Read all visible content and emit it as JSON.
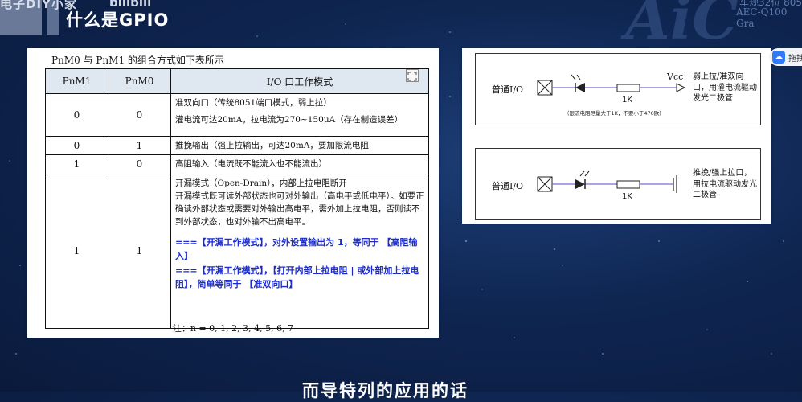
{
  "header": {
    "channel_name": "电子DIY小家",
    "bili_logo": "bilibili",
    "title": "什么是GPIO",
    "watermark_logo": "AiC",
    "watermark_top": "车规32位 805",
    "watermark_sub": "AEC-Q100 Gra"
  },
  "doc": {
    "caption": "PnM0 与 PnM1 的组合方式如下表所示",
    "columns": [
      "PnM1",
      "PnM0",
      "I/O 口工作模式"
    ],
    "rows": [
      {
        "m1": "0",
        "m0": "0",
        "lines": [
          "准双向口（传统8051端口模式，弱上拉）",
          "灌电流可达20mA，拉电流为270~150μA（存在制造误差）"
        ]
      },
      {
        "m1": "0",
        "m0": "1",
        "lines": [
          "推挽输出（强上拉输出，可达20mA，要加限流电阻"
        ]
      },
      {
        "m1": "1",
        "m0": "0",
        "lines": [
          "高阻输入（电流既不能流入也不能流出）"
        ]
      },
      {
        "m1": "1",
        "m0": "1",
        "lines": [
          "开漏模式（Open-Drain），内部上拉电阻断开",
          "开漏模式既可读外部状态也可对外输出（高电平或低电平）。如要正确读外部状态或需要对外输出高电平，需外加上拉电阻，否则读不到外部状态，也对外输不出高电平。"
        ],
        "notes": [
          "===【开漏工作模式】，对外设置输出为 1，等同于 【高阻输入】",
          "===【开漏工作模式】，【打开内部上拉电阻 | 或外部加上拉电阻】，简单等同于 【准双向口】"
        ]
      }
    ],
    "footnote": "注：n = 0, 1, 2, 3, 4, 5, 6, 7"
  },
  "circuit": {
    "top": {
      "io": "普通I/O",
      "resistor": "1K",
      "vcc": "Vcc",
      "note": "（限流电阻尽量大于1K，不要小于470欧）",
      "desc": "弱上拉/准双向口，用灌电流驱动发光二极管"
    },
    "bottom": {
      "io": "普通I/O",
      "resistor": "1K",
      "desc": "推挽/强上拉口，用拉电流驱动发光二极管"
    }
  },
  "share": {
    "text": "拖拽"
  },
  "subtitle": "而导特列的应用的话",
  "colors": {
    "background": "#0f2652",
    "table_header": "#dfe7f1",
    "blue_note": "#1a2bd0",
    "wire": "#7a6ad8"
  }
}
